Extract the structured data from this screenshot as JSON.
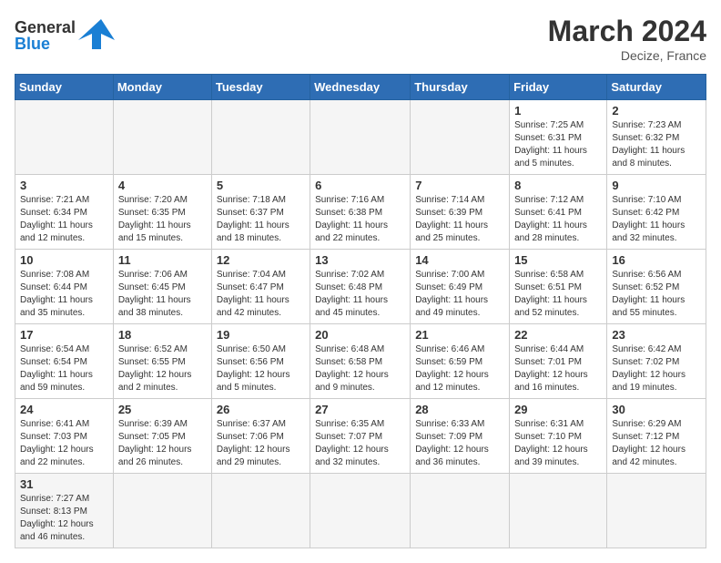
{
  "header": {
    "logo_general": "General",
    "logo_blue": "Blue",
    "month_title": "March 2024",
    "location": "Decize, France"
  },
  "days_of_week": [
    "Sunday",
    "Monday",
    "Tuesday",
    "Wednesday",
    "Thursday",
    "Friday",
    "Saturday"
  ],
  "weeks": [
    [
      {
        "day": "",
        "info": ""
      },
      {
        "day": "",
        "info": ""
      },
      {
        "day": "",
        "info": ""
      },
      {
        "day": "",
        "info": ""
      },
      {
        "day": "",
        "info": ""
      },
      {
        "day": "1",
        "info": "Sunrise: 7:25 AM\nSunset: 6:31 PM\nDaylight: 11 hours\nand 5 minutes."
      },
      {
        "day": "2",
        "info": "Sunrise: 7:23 AM\nSunset: 6:32 PM\nDaylight: 11 hours\nand 8 minutes."
      }
    ],
    [
      {
        "day": "3",
        "info": "Sunrise: 7:21 AM\nSunset: 6:34 PM\nDaylight: 11 hours\nand 12 minutes."
      },
      {
        "day": "4",
        "info": "Sunrise: 7:20 AM\nSunset: 6:35 PM\nDaylight: 11 hours\nand 15 minutes."
      },
      {
        "day": "5",
        "info": "Sunrise: 7:18 AM\nSunset: 6:37 PM\nDaylight: 11 hours\nand 18 minutes."
      },
      {
        "day": "6",
        "info": "Sunrise: 7:16 AM\nSunset: 6:38 PM\nDaylight: 11 hours\nand 22 minutes."
      },
      {
        "day": "7",
        "info": "Sunrise: 7:14 AM\nSunset: 6:39 PM\nDaylight: 11 hours\nand 25 minutes."
      },
      {
        "day": "8",
        "info": "Sunrise: 7:12 AM\nSunset: 6:41 PM\nDaylight: 11 hours\nand 28 minutes."
      },
      {
        "day": "9",
        "info": "Sunrise: 7:10 AM\nSunset: 6:42 PM\nDaylight: 11 hours\nand 32 minutes."
      }
    ],
    [
      {
        "day": "10",
        "info": "Sunrise: 7:08 AM\nSunset: 6:44 PM\nDaylight: 11 hours\nand 35 minutes."
      },
      {
        "day": "11",
        "info": "Sunrise: 7:06 AM\nSunset: 6:45 PM\nDaylight: 11 hours\nand 38 minutes."
      },
      {
        "day": "12",
        "info": "Sunrise: 7:04 AM\nSunset: 6:47 PM\nDaylight: 11 hours\nand 42 minutes."
      },
      {
        "day": "13",
        "info": "Sunrise: 7:02 AM\nSunset: 6:48 PM\nDaylight: 11 hours\nand 45 minutes."
      },
      {
        "day": "14",
        "info": "Sunrise: 7:00 AM\nSunset: 6:49 PM\nDaylight: 11 hours\nand 49 minutes."
      },
      {
        "day": "15",
        "info": "Sunrise: 6:58 AM\nSunset: 6:51 PM\nDaylight: 11 hours\nand 52 minutes."
      },
      {
        "day": "16",
        "info": "Sunrise: 6:56 AM\nSunset: 6:52 PM\nDaylight: 11 hours\nand 55 minutes."
      }
    ],
    [
      {
        "day": "17",
        "info": "Sunrise: 6:54 AM\nSunset: 6:54 PM\nDaylight: 11 hours\nand 59 minutes."
      },
      {
        "day": "18",
        "info": "Sunrise: 6:52 AM\nSunset: 6:55 PM\nDaylight: 12 hours\nand 2 minutes."
      },
      {
        "day": "19",
        "info": "Sunrise: 6:50 AM\nSunset: 6:56 PM\nDaylight: 12 hours\nand 5 minutes."
      },
      {
        "day": "20",
        "info": "Sunrise: 6:48 AM\nSunset: 6:58 PM\nDaylight: 12 hours\nand 9 minutes."
      },
      {
        "day": "21",
        "info": "Sunrise: 6:46 AM\nSunset: 6:59 PM\nDaylight: 12 hours\nand 12 minutes."
      },
      {
        "day": "22",
        "info": "Sunrise: 6:44 AM\nSunset: 7:01 PM\nDaylight: 12 hours\nand 16 minutes."
      },
      {
        "day": "23",
        "info": "Sunrise: 6:42 AM\nSunset: 7:02 PM\nDaylight: 12 hours\nand 19 minutes."
      }
    ],
    [
      {
        "day": "24",
        "info": "Sunrise: 6:41 AM\nSunset: 7:03 PM\nDaylight: 12 hours\nand 22 minutes."
      },
      {
        "day": "25",
        "info": "Sunrise: 6:39 AM\nSunset: 7:05 PM\nDaylight: 12 hours\nand 26 minutes."
      },
      {
        "day": "26",
        "info": "Sunrise: 6:37 AM\nSunset: 7:06 PM\nDaylight: 12 hours\nand 29 minutes."
      },
      {
        "day": "27",
        "info": "Sunrise: 6:35 AM\nSunset: 7:07 PM\nDaylight: 12 hours\nand 32 minutes."
      },
      {
        "day": "28",
        "info": "Sunrise: 6:33 AM\nSunset: 7:09 PM\nDaylight: 12 hours\nand 36 minutes."
      },
      {
        "day": "29",
        "info": "Sunrise: 6:31 AM\nSunset: 7:10 PM\nDaylight: 12 hours\nand 39 minutes."
      },
      {
        "day": "30",
        "info": "Sunrise: 6:29 AM\nSunset: 7:12 PM\nDaylight: 12 hours\nand 42 minutes."
      }
    ],
    [
      {
        "day": "31",
        "info": "Sunrise: 7:27 AM\nSunset: 8:13 PM\nDaylight: 12 hours\nand 46 minutes."
      },
      {
        "day": "",
        "info": ""
      },
      {
        "day": "",
        "info": ""
      },
      {
        "day": "",
        "info": ""
      },
      {
        "day": "",
        "info": ""
      },
      {
        "day": "",
        "info": ""
      },
      {
        "day": "",
        "info": ""
      }
    ]
  ]
}
